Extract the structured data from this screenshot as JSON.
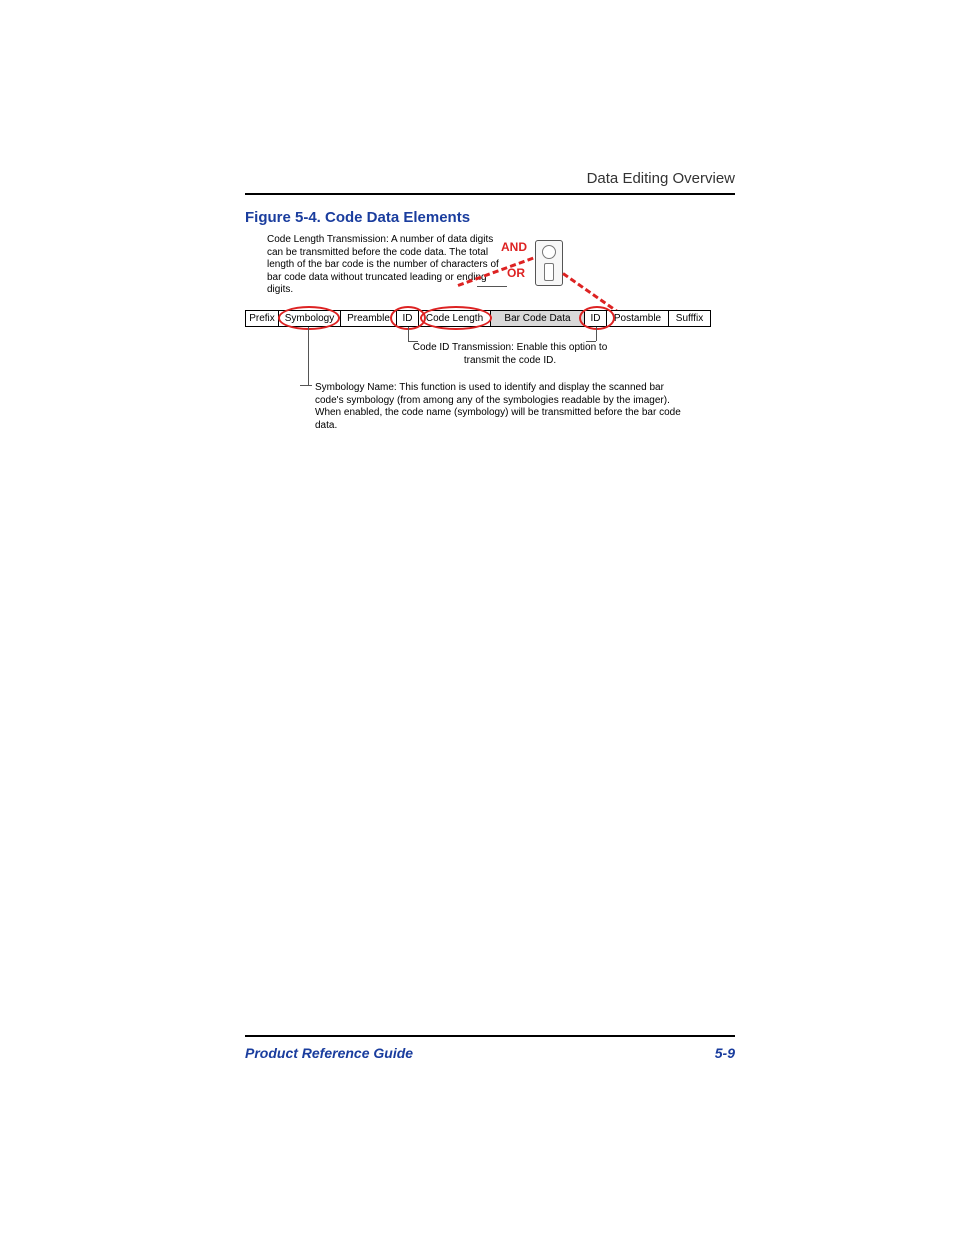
{
  "header": {
    "running_head": "Data Editing Overview"
  },
  "figure": {
    "title": "Figure 5-4. Code Data Elements"
  },
  "callouts": {
    "code_length": "Code Length Transmission: A number of data digits can be transmitted before the code data. The total length of the bar code is the number of characters of bar code data without truncated leading or ending digits.",
    "and": "AND",
    "or": "OR",
    "code_id": "Code ID Transmission: Enable this option to transmit the code ID.",
    "symbology": "Symbology Name: This function is used to identify and display the scanned bar code's symbology (from among any of the symbologies readable by the imager). When enabled, the code name (symbology) will be transmitted before the bar code data."
  },
  "segments": [
    "Prefix",
    "Symbology",
    "Preamble",
    "ID",
    "Code Length",
    "Bar Code Data",
    "ID",
    "Postamble",
    "Sufffix"
  ],
  "footer": {
    "left": "Product Reference Guide",
    "right": "5-9"
  }
}
